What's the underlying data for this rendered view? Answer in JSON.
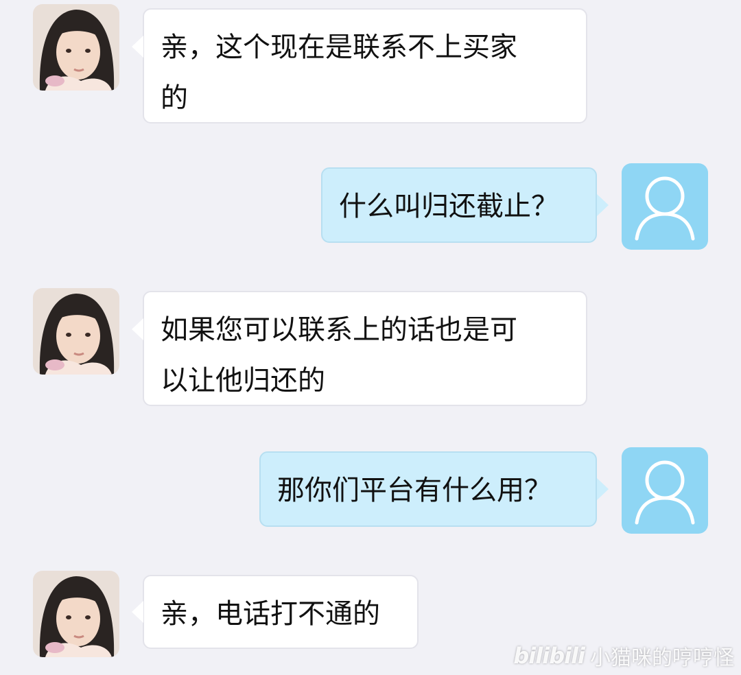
{
  "chat": {
    "messages": [
      {
        "side": "left",
        "lines": [
          "亲，这个现在是联系不上买家",
          "的"
        ]
      },
      {
        "side": "right",
        "lines": [
          "什么叫归还截止？"
        ]
      },
      {
        "side": "left",
        "lines": [
          "如果您可以联系上的话也是可",
          "以让他归还的"
        ]
      },
      {
        "side": "right",
        "lines": [
          "那你们平台有什么用？"
        ]
      },
      {
        "side": "left",
        "lines": [
          "亲，电话打不通的"
        ]
      }
    ]
  },
  "icons": {
    "agent_avatar": "agent-photo-avatar",
    "user_avatar": "user-silhouette-icon"
  },
  "colors": {
    "background": "#f1f1f6",
    "agent_bubble": "#ffffff",
    "user_bubble": "#cdeefc",
    "user_avatar": "#8fd6f4"
  },
  "watermark": {
    "logo": "bilibili",
    "uploader": "小猫咪的哼哼怪"
  }
}
